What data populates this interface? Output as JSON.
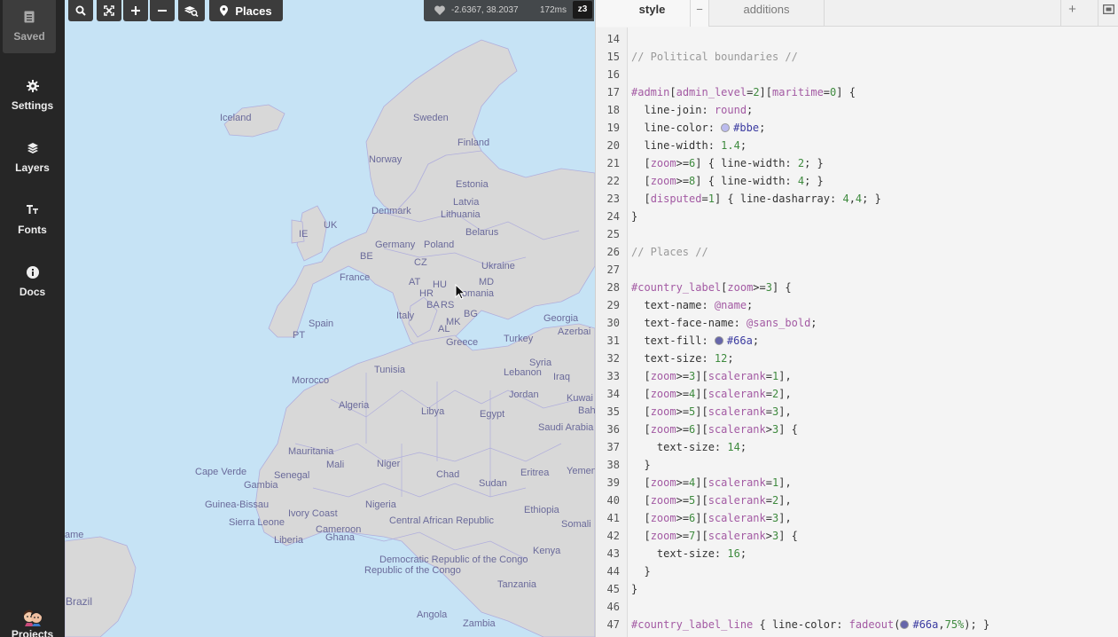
{
  "sidebar": {
    "items": [
      {
        "label": "Saved",
        "icon": "document-icon"
      },
      {
        "label": "Settings",
        "icon": "gear-icon"
      },
      {
        "label": "Layers",
        "icon": "layers-icon"
      },
      {
        "label": "Fonts",
        "icon": "fonts-icon"
      },
      {
        "label": "Docs",
        "icon": "info-icon"
      },
      {
        "label": "Projects",
        "icon": "avatar"
      }
    ]
  },
  "toolbar": {
    "places_label": "Places",
    "coordinates": "-2.6367, 38.2037",
    "render_time": "172ms",
    "zoom": "z3"
  },
  "tabs": {
    "style": "style",
    "style_close": "−",
    "additions": "additions",
    "add": "+"
  },
  "map": {
    "labels": [
      {
        "text": "Iceland",
        "cls": ""
      },
      {
        "text": "Sweden",
        "cls": ""
      },
      {
        "text": "Finland",
        "cls": ""
      },
      {
        "text": "Norway",
        "cls": ""
      },
      {
        "text": "Estonia",
        "cls": ""
      },
      {
        "text": "Latvia",
        "cls": ""
      },
      {
        "text": "Denmark",
        "cls": ""
      },
      {
        "text": "Lithuania",
        "cls": ""
      },
      {
        "text": "UK",
        "cls": ""
      },
      {
        "text": "IE",
        "cls": ""
      },
      {
        "text": "Belarus",
        "cls": ""
      },
      {
        "text": "Germany",
        "cls": ""
      },
      {
        "text": "Poland",
        "cls": ""
      },
      {
        "text": "BE",
        "cls": ""
      },
      {
        "text": "CZ",
        "cls": ""
      },
      {
        "text": "Ukraine",
        "cls": ""
      },
      {
        "text": "France",
        "cls": ""
      },
      {
        "text": "AT",
        "cls": ""
      },
      {
        "text": "HU",
        "cls": ""
      },
      {
        "text": "MD",
        "cls": ""
      },
      {
        "text": "HR",
        "cls": ""
      },
      {
        "text": "Romania",
        "cls": ""
      },
      {
        "text": "BA",
        "cls": ""
      },
      {
        "text": "RS",
        "cls": ""
      },
      {
        "text": "Italy",
        "cls": ""
      },
      {
        "text": "BG",
        "cls": ""
      },
      {
        "text": "Georgia",
        "cls": ""
      },
      {
        "text": "Spain",
        "cls": ""
      },
      {
        "text": "MK",
        "cls": ""
      },
      {
        "text": "AL",
        "cls": ""
      },
      {
        "text": "Azerbai",
        "cls": ""
      },
      {
        "text": "PT",
        "cls": ""
      },
      {
        "text": "Greece",
        "cls": ""
      },
      {
        "text": "Turkey",
        "cls": ""
      },
      {
        "text": "Syria",
        "cls": ""
      },
      {
        "text": "Tunisia",
        "cls": ""
      },
      {
        "text": "Lebanon",
        "cls": ""
      },
      {
        "text": "Iraq",
        "cls": ""
      },
      {
        "text": "Morocco",
        "cls": ""
      },
      {
        "text": "Jordan",
        "cls": ""
      },
      {
        "text": "Kuwai",
        "cls": ""
      },
      {
        "text": "Bah",
        "cls": ""
      },
      {
        "text": "Algeria",
        "cls": ""
      },
      {
        "text": "Libya",
        "cls": ""
      },
      {
        "text": "Egypt",
        "cls": ""
      },
      {
        "text": "Saudi Arabia",
        "cls": ""
      },
      {
        "text": "Mauritania",
        "cls": ""
      },
      {
        "text": "Mali",
        "cls": ""
      },
      {
        "text": "Niger",
        "cls": ""
      },
      {
        "text": "Cape Verde",
        "cls": ""
      },
      {
        "text": "Senegal",
        "cls": ""
      },
      {
        "text": "Chad",
        "cls": ""
      },
      {
        "text": "Sudan",
        "cls": ""
      },
      {
        "text": "Eritrea",
        "cls": ""
      },
      {
        "text": "Yemen",
        "cls": ""
      },
      {
        "text": "Gambia",
        "cls": ""
      },
      {
        "text": "Guinea-Bissau",
        "cls": ""
      },
      {
        "text": "Nigeria",
        "cls": ""
      },
      {
        "text": "Ethiopia",
        "cls": ""
      },
      {
        "text": "Ivory Coast",
        "cls": ""
      },
      {
        "text": "Sierra Leone",
        "cls": ""
      },
      {
        "text": "Central African Republic",
        "cls": ""
      },
      {
        "text": "Somali",
        "cls": ""
      },
      {
        "text": "Cameroon",
        "cls": ""
      },
      {
        "text": "ame",
        "cls": ""
      },
      {
        "text": "Liberia",
        "cls": ""
      },
      {
        "text": "Ghana",
        "cls": ""
      },
      {
        "text": "Kenya",
        "cls": ""
      },
      {
        "text": "Democratic Republic of the Congo",
        "cls": ""
      },
      {
        "text": "Republic of the Congo",
        "cls": ""
      },
      {
        "text": "Tanzania",
        "cls": ""
      },
      {
        "text": "Brazil",
        "cls": "big"
      },
      {
        "text": "Angola",
        "cls": ""
      },
      {
        "text": "Zambia",
        "cls": ""
      }
    ]
  },
  "code": [
    {
      "n": "14",
      "t": []
    },
    {
      "n": "15",
      "t": [
        [
          "c-cm",
          "// Political boundaries //"
        ]
      ]
    },
    {
      "n": "16",
      "t": []
    },
    {
      "n": "17",
      "t": [
        [
          "c-id",
          "#admin"
        ],
        [
          "",
          "["
        ],
        [
          "c-kw",
          "admin_level"
        ],
        [
          "",
          "="
        ],
        [
          "c-num",
          "2"
        ],
        [
          "",
          "]["
        ],
        [
          "c-kw",
          "maritime"
        ],
        [
          "",
          "="
        ],
        [
          "c-num",
          "0"
        ],
        [
          "",
          "] {"
        ]
      ]
    },
    {
      "n": "18",
      "t": [
        [
          "",
          "  line-join: "
        ],
        [
          "c-var",
          "round"
        ],
        [
          "",
          ";"
        ]
      ]
    },
    {
      "n": "19",
      "t": [
        [
          "",
          "  line-color: "
        ],
        [
          "sw:#bbe",
          ""
        ],
        [
          "c-col",
          "#bbe"
        ],
        [
          "",
          ";"
        ]
      ]
    },
    {
      "n": "20",
      "t": [
        [
          "",
          "  line-width: "
        ],
        [
          "c-num",
          "1.4"
        ],
        [
          "",
          ";"
        ]
      ]
    },
    {
      "n": "21",
      "t": [
        [
          "",
          "  ["
        ],
        [
          "c-kw",
          "zoom"
        ],
        [
          "",
          ">="
        ],
        [
          "c-num",
          "6"
        ],
        [
          "",
          "] { line-width: "
        ],
        [
          "c-num",
          "2"
        ],
        [
          "",
          "; }"
        ]
      ]
    },
    {
      "n": "22",
      "t": [
        [
          "",
          "  ["
        ],
        [
          "c-kw",
          "zoom"
        ],
        [
          "",
          ">="
        ],
        [
          "c-num",
          "8"
        ],
        [
          "",
          "] { line-width: "
        ],
        [
          "c-num",
          "4"
        ],
        [
          "",
          "; }"
        ]
      ]
    },
    {
      "n": "23",
      "t": [
        [
          "",
          "  ["
        ],
        [
          "c-kw",
          "disputed"
        ],
        [
          "",
          "="
        ],
        [
          "c-num",
          "1"
        ],
        [
          "",
          "] { line-dasharray: "
        ],
        [
          "c-num",
          "4"
        ],
        [
          "",
          ","
        ],
        [
          "c-num",
          "4"
        ],
        [
          "",
          "; }"
        ]
      ]
    },
    {
      "n": "24",
      "t": [
        [
          "",
          "}"
        ]
      ]
    },
    {
      "n": "25",
      "t": []
    },
    {
      "n": "26",
      "t": [
        [
          "c-cm",
          "// Places //"
        ]
      ]
    },
    {
      "n": "27",
      "t": []
    },
    {
      "n": "28",
      "t": [
        [
          "c-id",
          "#country_label"
        ],
        [
          "",
          "["
        ],
        [
          "c-kw",
          "zoom"
        ],
        [
          "",
          ">="
        ],
        [
          "c-num",
          "3"
        ],
        [
          "",
          "] {"
        ]
      ]
    },
    {
      "n": "29",
      "t": [
        [
          "",
          "  text-name: "
        ],
        [
          "c-var",
          "@name"
        ],
        [
          "",
          ";"
        ]
      ]
    },
    {
      "n": "30",
      "t": [
        [
          "",
          "  text-face-name: "
        ],
        [
          "c-var",
          "@sans_bold"
        ],
        [
          "",
          ";"
        ]
      ]
    },
    {
      "n": "31",
      "t": [
        [
          "",
          "  text-fill: "
        ],
        [
          "sw:#66a",
          ""
        ],
        [
          "c-col",
          "#66a"
        ],
        [
          "",
          ";"
        ]
      ]
    },
    {
      "n": "32",
      "t": [
        [
          "",
          "  text-size: "
        ],
        [
          "c-num",
          "12"
        ],
        [
          "",
          ";"
        ]
      ]
    },
    {
      "n": "33",
      "t": [
        [
          "",
          "  ["
        ],
        [
          "c-kw",
          "zoom"
        ],
        [
          "",
          ">="
        ],
        [
          "c-num",
          "3"
        ],
        [
          "",
          "]["
        ],
        [
          "c-kw",
          "scalerank"
        ],
        [
          "",
          "="
        ],
        [
          "c-num",
          "1"
        ],
        [
          "",
          "],"
        ]
      ]
    },
    {
      "n": "34",
      "t": [
        [
          "",
          "  ["
        ],
        [
          "c-kw",
          "zoom"
        ],
        [
          "",
          ">="
        ],
        [
          "c-num",
          "4"
        ],
        [
          "",
          "]["
        ],
        [
          "c-kw",
          "scalerank"
        ],
        [
          "",
          "="
        ],
        [
          "c-num",
          "2"
        ],
        [
          "",
          "],"
        ]
      ]
    },
    {
      "n": "35",
      "t": [
        [
          "",
          "  ["
        ],
        [
          "c-kw",
          "zoom"
        ],
        [
          "",
          ">="
        ],
        [
          "c-num",
          "5"
        ],
        [
          "",
          "]["
        ],
        [
          "c-kw",
          "scalerank"
        ],
        [
          "",
          "="
        ],
        [
          "c-num",
          "3"
        ],
        [
          "",
          "],"
        ]
      ]
    },
    {
      "n": "36",
      "t": [
        [
          "",
          "  ["
        ],
        [
          "c-kw",
          "zoom"
        ],
        [
          "",
          ">="
        ],
        [
          "c-num",
          "6"
        ],
        [
          "",
          "]["
        ],
        [
          "c-kw",
          "scalerank"
        ],
        [
          "",
          ">"
        ],
        [
          "c-num",
          "3"
        ],
        [
          "",
          "] {"
        ]
      ]
    },
    {
      "n": "37",
      "t": [
        [
          "",
          "    text-size: "
        ],
        [
          "c-num",
          "14"
        ],
        [
          "",
          ";"
        ]
      ]
    },
    {
      "n": "38",
      "t": [
        [
          "",
          "  }"
        ]
      ]
    },
    {
      "n": "39",
      "t": [
        [
          "",
          "  ["
        ],
        [
          "c-kw",
          "zoom"
        ],
        [
          "",
          ">="
        ],
        [
          "c-num",
          "4"
        ],
        [
          "",
          "]["
        ],
        [
          "c-kw",
          "scalerank"
        ],
        [
          "",
          "="
        ],
        [
          "c-num",
          "1"
        ],
        [
          "",
          "],"
        ]
      ]
    },
    {
      "n": "40",
      "t": [
        [
          "",
          "  ["
        ],
        [
          "c-kw",
          "zoom"
        ],
        [
          "",
          ">="
        ],
        [
          "c-num",
          "5"
        ],
        [
          "",
          "]["
        ],
        [
          "c-kw",
          "scalerank"
        ],
        [
          "",
          "="
        ],
        [
          "c-num",
          "2"
        ],
        [
          "",
          "],"
        ]
      ]
    },
    {
      "n": "41",
      "t": [
        [
          "",
          "  ["
        ],
        [
          "c-kw",
          "zoom"
        ],
        [
          "",
          ">="
        ],
        [
          "c-num",
          "6"
        ],
        [
          "",
          "]["
        ],
        [
          "c-kw",
          "scalerank"
        ],
        [
          "",
          "="
        ],
        [
          "c-num",
          "3"
        ],
        [
          "",
          "],"
        ]
      ]
    },
    {
      "n": "42",
      "t": [
        [
          "",
          "  ["
        ],
        [
          "c-kw",
          "zoom"
        ],
        [
          "",
          ">="
        ],
        [
          "c-num",
          "7"
        ],
        [
          "",
          "]["
        ],
        [
          "c-kw",
          "scalerank"
        ],
        [
          "",
          ">"
        ],
        [
          "c-num",
          "3"
        ],
        [
          "",
          "] {"
        ]
      ]
    },
    {
      "n": "43",
      "t": [
        [
          "",
          "    text-size: "
        ],
        [
          "c-num",
          "16"
        ],
        [
          "",
          ";"
        ]
      ]
    },
    {
      "n": "44",
      "t": [
        [
          "",
          "  }"
        ]
      ]
    },
    {
      "n": "45",
      "t": [
        [
          "",
          "}"
        ]
      ]
    },
    {
      "n": "46",
      "t": []
    },
    {
      "n": "47",
      "t": [
        [
          "c-id",
          "#country_label_line"
        ],
        [
          "",
          " { line-color: "
        ],
        [
          "c-fn",
          "fadeout"
        ],
        [
          "",
          "("
        ],
        [
          "sw:#66a",
          ""
        ],
        [
          "c-col",
          "#66a"
        ],
        [
          "",
          ","
        ],
        [
          "c-num",
          "75%"
        ],
        [
          "",
          "); }"
        ]
      ]
    }
  ]
}
